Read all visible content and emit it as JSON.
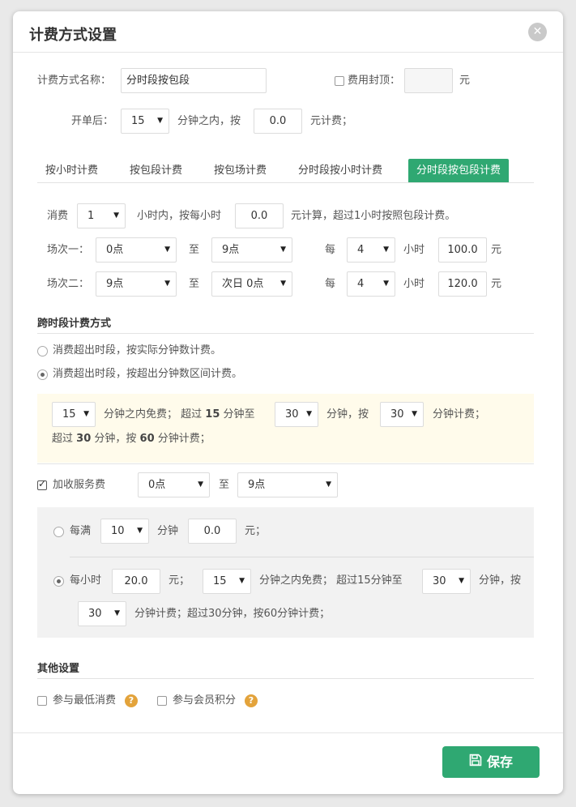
{
  "dialog": {
    "title": "计费方式设置"
  },
  "form": {
    "name_label": "计费方式名称：",
    "name_value": "分时段按包段",
    "cap_label": "费用封顶：",
    "cap_value": "",
    "cap_unit": "元",
    "start_label": "开单后：",
    "start_minutes": "15",
    "start_mid": "分钟之内，按",
    "start_amount": "0.0",
    "start_suffix": "元计费；"
  },
  "tabs": [
    {
      "label": "按小时计费",
      "active": false
    },
    {
      "label": "按包段计费",
      "active": false
    },
    {
      "label": "按包场计费",
      "active": false
    },
    {
      "label": "分时段按小时计费",
      "active": false
    },
    {
      "label": "分时段按包段计费",
      "active": true
    }
  ],
  "consume": {
    "prefix": "消费",
    "hours": "1",
    "mid": "小时内，按每小时",
    "rate": "0.0",
    "suffix": "元计算，超过1小时按照包段计费。"
  },
  "sessions": [
    {
      "label": "场次一：",
      "from": "0点",
      "to_label": "至",
      "to": "9点",
      "every_label": "每",
      "every": "4",
      "hour_label": "小时",
      "price": "100.0",
      "unit": "元"
    },
    {
      "label": "场次二：",
      "from": "9点",
      "to_label": "至",
      "to": "次日 0点",
      "every_label": "每",
      "every": "4",
      "hour_label": "小时",
      "price": "120.0",
      "unit": "元"
    }
  ],
  "cross": {
    "title": "跨时段计费方式",
    "option1": "消费超出时段，按实际分钟数计费。",
    "option2": "消费超出时段，按超出分钟数区间计费。",
    "selected": 2
  },
  "range_box": {
    "free_minutes": "15",
    "t1": "分钟之内免费；  超过",
    "t1b": "15",
    "t2": "分钟至",
    "to_minutes": "30",
    "t3": "分钟，按",
    "charge_minutes": "30",
    "t4": "分钟计费；",
    "l2a": "超过",
    "l2b": "30",
    "l2c": "分钟，按",
    "l2d": "60",
    "l2e": "分钟计费；"
  },
  "service": {
    "checked": true,
    "label": "加收服务费",
    "from": "0点",
    "to_label": "至",
    "to": "9点",
    "per_label": "每满",
    "per_minutes": "10",
    "per_unit": "分钟",
    "per_amount": "0.0",
    "per_suffix": "元；",
    "hour_label": "每小时",
    "hour_amount": "20.0",
    "hour_unit": "元；",
    "free_minutes": "15",
    "free_text": "分钟之内免费；  超过15分钟至",
    "to_minutes": "30",
    "by_text": "分钟，按",
    "charge_minutes": "30",
    "tail_text": "分钟计费；超过30分钟，按60分钟计费；",
    "selected": "hour"
  },
  "other": {
    "title": "其他设置",
    "min_consume": "参与最低消费",
    "member_points": "参与会员积分"
  },
  "footer": {
    "save_label": "保存"
  },
  "colors": {
    "accent": "#2fa872",
    "help": "#e3a33b"
  }
}
